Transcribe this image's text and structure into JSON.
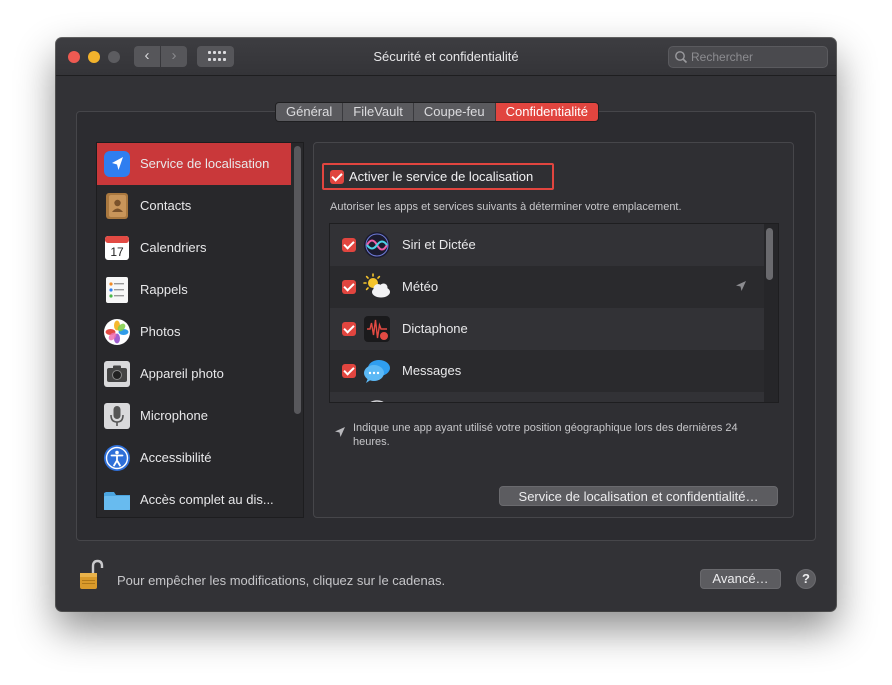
{
  "window": {
    "title": "Sécurité et confidentialité",
    "search_placeholder": "Rechercher"
  },
  "tabs": [
    {
      "label": "Général",
      "active": false
    },
    {
      "label": "FileVault",
      "active": false
    },
    {
      "label": "Coupe-feu",
      "active": false
    },
    {
      "label": "Confidentialité",
      "active": true
    }
  ],
  "sidebar": {
    "items": [
      {
        "label": "Service de localisation",
        "icon": "location-arrow-icon",
        "selected": true
      },
      {
        "label": "Contacts",
        "icon": "contacts-book-icon",
        "selected": false
      },
      {
        "label": "Calendriers",
        "icon": "calendar-icon",
        "selected": false
      },
      {
        "label": "Rappels",
        "icon": "reminders-icon",
        "selected": false
      },
      {
        "label": "Photos",
        "icon": "photos-icon",
        "selected": false
      },
      {
        "label": "Appareil photo",
        "icon": "camera-icon",
        "selected": false
      },
      {
        "label": "Microphone",
        "icon": "microphone-icon",
        "selected": false
      },
      {
        "label": "Accessibilité",
        "icon": "accessibility-icon",
        "selected": false
      },
      {
        "label": "Accès complet au dis...",
        "icon": "folder-icon",
        "selected": false
      }
    ]
  },
  "panel": {
    "master_checkbox_label": "Activer le service de localisation",
    "master_checked": true,
    "description": "Autoriser les apps et services suivants à déterminer votre emplacement.",
    "apps": [
      {
        "label": "Siri et Dictée",
        "icon": "siri-icon",
        "checked": true,
        "recent_location": false
      },
      {
        "label": "Météo",
        "icon": "weather-icon",
        "checked": true,
        "recent_location": true
      },
      {
        "label": "Dictaphone",
        "icon": "voice-memos-icon",
        "checked": true,
        "recent_location": false
      },
      {
        "label": "Messages",
        "icon": "messages-icon",
        "checked": true,
        "recent_location": false
      }
    ],
    "note": "Indique une app ayant utilisé votre position géographique lors des dernières 24 heures.",
    "details_button": "Service de localisation et confidentialité…"
  },
  "footer": {
    "lock_text": "Pour empêcher les modifications, cliquez sur le cadenas.",
    "advanced_button": "Avancé…",
    "help_button": "?"
  },
  "colors": {
    "accent": "#e1453f",
    "selection": "#c9383a",
    "window_bg": "#323236"
  }
}
